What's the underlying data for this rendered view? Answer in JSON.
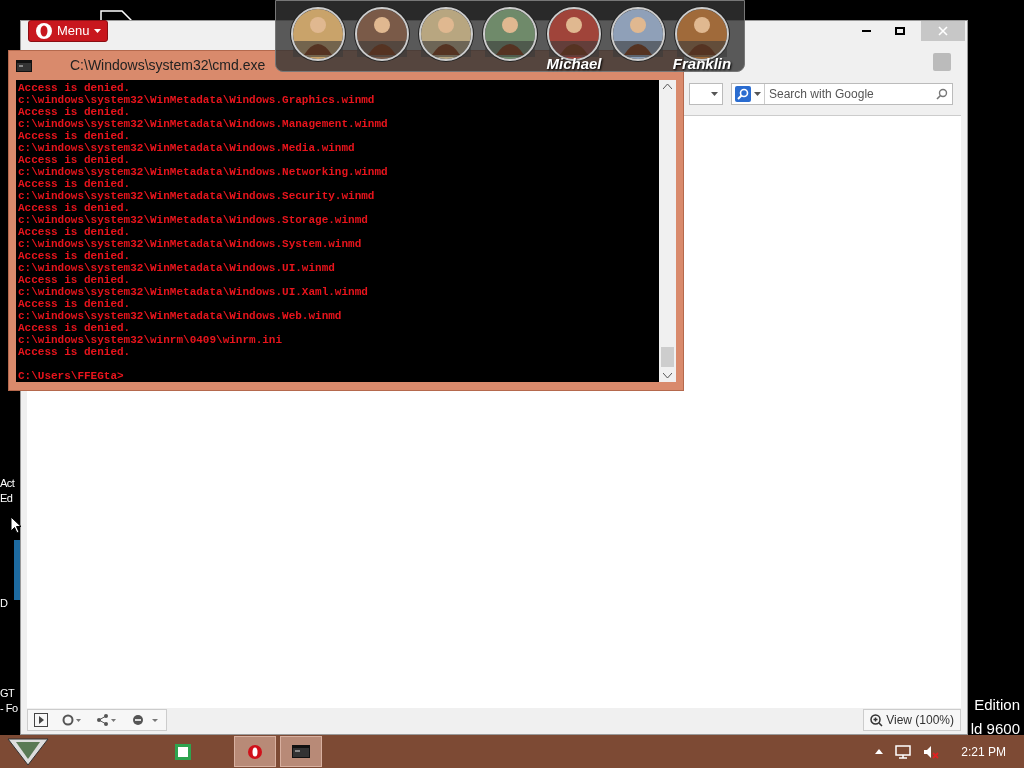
{
  "desktop": {
    "left_labels": [
      "Act",
      "Ed",
      "D",
      "GT",
      "- Fo"
    ],
    "right_labels": [
      "Edition",
      "ld 9600"
    ]
  },
  "browser": {
    "menu_button": "Menu",
    "search": {
      "placeholder": "Search with Google"
    },
    "zoom": "View (100%)"
  },
  "cmd": {
    "title": "C:\\Windows\\system32\\cmd.exe",
    "lines": [
      "Access is denied.",
      "c:\\windows\\system32\\WinMetadata\\Windows.Graphics.winmd",
      "Access is denied.",
      "c:\\windows\\system32\\WinMetadata\\Windows.Management.winmd",
      "Access is denied.",
      "c:\\windows\\system32\\WinMetadata\\Windows.Media.winmd",
      "Access is denied.",
      "c:\\windows\\system32\\WinMetadata\\Windows.Networking.winmd",
      "Access is denied.",
      "c:\\windows\\system32\\WinMetadata\\Windows.Security.winmd",
      "Access is denied.",
      "c:\\windows\\system32\\WinMetadata\\Windows.Storage.winmd",
      "Access is denied.",
      "c:\\windows\\system32\\WinMetadata\\Windows.System.winmd",
      "Access is denied.",
      "c:\\windows\\system32\\WinMetadata\\Windows.UI.winmd",
      "Access is denied.",
      "c:\\windows\\system32\\WinMetadata\\Windows.UI.Xaml.winmd",
      "Access is denied.",
      "c:\\windows\\system32\\WinMetadata\\Windows.Web.winmd",
      "Access is denied.",
      "c:\\windows\\system32\\winrm\\0409\\winrm.ini",
      "Access is denied."
    ],
    "prompt": "C:\\Users\\FFEGta>"
  },
  "dock": [
    {
      "kind": "picture"
    },
    {
      "kind": "picture"
    },
    {
      "kind": "picture"
    },
    {
      "kind": "picture"
    },
    {
      "kind": "picture",
      "label": "Michael"
    },
    {
      "kind": "picture"
    },
    {
      "kind": "picture",
      "label": "Franklin"
    }
  ],
  "taskbar": {
    "apps": [
      {
        "kind": "sheet",
        "selected": false
      },
      {
        "kind": "opera",
        "selected": true
      },
      {
        "kind": "cmd",
        "selected": true
      }
    ],
    "clock": "2:21 PM"
  }
}
